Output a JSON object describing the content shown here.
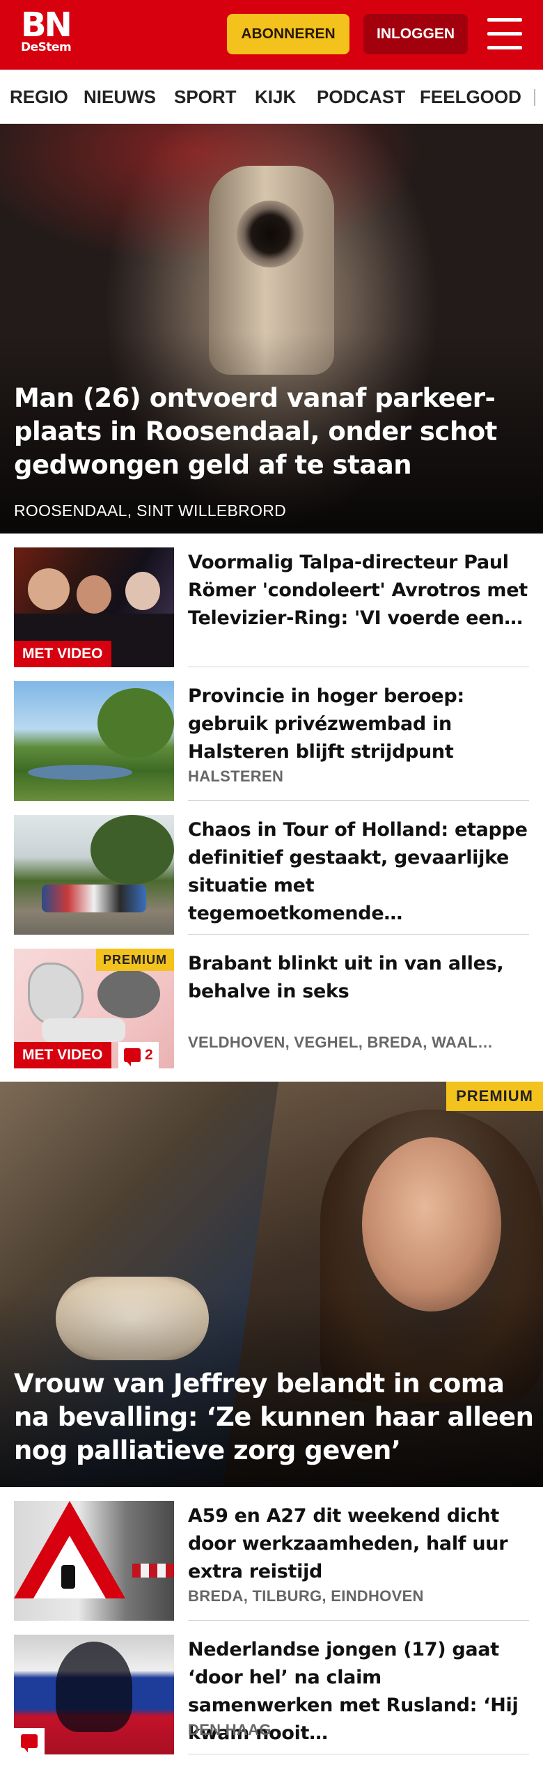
{
  "header": {
    "logo_main": "BN",
    "logo_sub": "DeStem",
    "subscribe_label": "ABONNEREN",
    "login_label": "INLOGGEN",
    "colors": {
      "brand": "#d7000f",
      "subscribe": "#f4c21d",
      "login": "#a3000d"
    }
  },
  "nav": {
    "items": [
      "REGIO",
      "NIEUWS",
      "SPORT",
      "KIJK",
      "PODCAST",
      "FEELGOOD"
    ]
  },
  "hero": {
    "title": "Man (26) ontvoerd vanaf parkeer­plaats in Roosendaal, onder schot gedwongen geld af te staan",
    "location": "ROOSENDAAL, SINT WILLEBRORD"
  },
  "articles": [
    {
      "title": "Voormalig Talpa-directeur Paul Römer 'condoleert' Avrotros met Televizier-Ring: 'VI voerde een…",
      "badge_video": "MET VIDEO"
    },
    {
      "title": "Provincie in hoger beroep: gebruik privézwembad in Halsteren blijft strijdpunt",
      "location": "HALSTEREN"
    },
    {
      "title": "Chaos in Tour of Holland: etappe definitief gestaakt, gevaarlijke situatie met tegemoetkomende…"
    },
    {
      "title": "Brabant blinkt uit in van alles, behalve in seks",
      "location": "VELDHOVEN, VEGHEL, BREDA, WAAL…",
      "badge_video": "MET VIDEO",
      "badge_premium": "PREMIUM",
      "comment_count": "2"
    }
  ],
  "feature": {
    "badge_premium": "PREMIUM",
    "title": "Vrouw van Jeffrey belandt in coma na bevalling: ‘Ze kunnen haar alleen nog palliatieve zorg geven’"
  },
  "articles2": [
    {
      "title": "A59 en A27 dit weekend dicht door werkzaamheden, half uur extra reistijd",
      "location": "BREDA, TILBURG, EINDHOVEN"
    },
    {
      "title": "Nederlandse jongen (17) gaat ‘door hel’ na claim samenwerken met Rusland: ‘Hij kwam nooit…",
      "location": "DEN HAAG"
    }
  ]
}
